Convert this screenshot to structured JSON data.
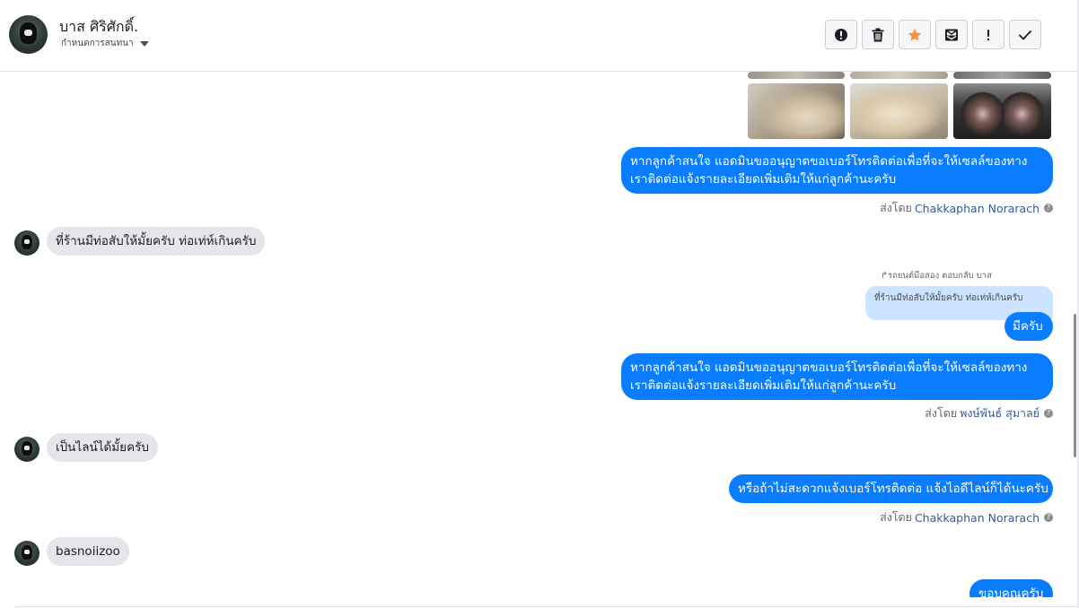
{
  "header": {
    "contact_name": "บาส ศิริศักดิ์.",
    "assign_label": "กำหนดการสนทนา",
    "toolbar": {
      "icons": [
        "alert-circle-icon",
        "trash-icon",
        "star-icon",
        "mark-unread-icon",
        "exclamation-icon",
        "check-icon"
      ],
      "star_color": "#f7923a"
    }
  },
  "messages": {
    "m1": "หากลูกค้าสนใจ แอดมินขออนุญาตขอเบอร์โทรติดต่อเพื่อที่จะให้เซลล์ของทางเราติดต่อแจ้งรายละเอียดเพิ่มเติมให้แก่ลูกค้านะครับ",
    "m1_sentby_prefix": "ส่งโดย",
    "m1_sentby_name": "Chakkaphan Norarach",
    "m2": "ที่ร้านมีท่อสับให้มั้ยครับ ท่อเท่ห์เกินครับ",
    "reply_label": "รถยนต์มือสอง ตอบกลับ บาส",
    "reply_quote": "ที่ร้านมีท่อสับให้มั้ยครับ ท่อเท่ห์เกินครับ",
    "m3": "มีครับ",
    "m4": "หากลูกค้าสนใจ แอดมินขออนุญาตขอเบอร์โทรติดต่อเพื่อที่จะให้เซลล์ของทางเราติดต่อแจ้งรายละเอียดเพิ่มเติมให้แก่ลูกค้านะครับ",
    "m4_sentby_prefix": "ส่งโดย",
    "m4_sentby_name": "พงษ์พันธ์ สุมาลย์",
    "m5": "เป็นไลน์ได้มั้ยครับ",
    "m6": "หรือถ้าไม่สะดวกแจ้งเบอร์โทรติดต่อ แจ้งไอดีไลน์ก็ได้นะครับ",
    "m6_sentby_prefix": "ส่งโดย",
    "m6_sentby_name": "Chakkaphan Norarach",
    "m7": "basnoiizoo",
    "m8": "ขอบคุณครับ",
    "help_glyph": "?"
  },
  "colors": {
    "outgoing_bubble": "#0a7cff",
    "incoming_bubble": "#e4e6eb",
    "reply_quote_bg": "#cce4ff"
  }
}
